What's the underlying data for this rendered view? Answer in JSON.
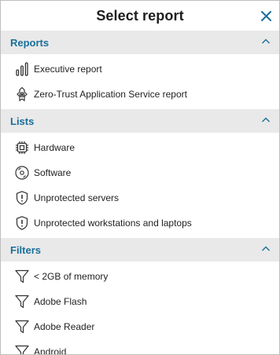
{
  "dialog": {
    "title": "Select report"
  },
  "colors": {
    "section_title": "#1a6f9a",
    "close_icon": "#1a6f9a",
    "section_bg": "#e9e9e9"
  },
  "sections": [
    {
      "title": "Reports",
      "items": [
        {
          "label": "Executive report",
          "icon": "bar-chart-icon"
        },
        {
          "label": "Zero-Trust Application Service report",
          "icon": "zero-trust-shield-icon"
        }
      ]
    },
    {
      "title": "Lists",
      "items": [
        {
          "label": "Hardware",
          "icon": "chip-icon"
        },
        {
          "label": "Software",
          "icon": "disc-icon"
        },
        {
          "label": "Unprotected servers",
          "icon": "shield-warning-icon"
        },
        {
          "label": "Unprotected workstations and laptops",
          "icon": "shield-warning-icon"
        }
      ]
    },
    {
      "title": "Filters",
      "items": [
        {
          "label": "< 2GB of memory",
          "icon": "filter-icon"
        },
        {
          "label": "Adobe Flash",
          "icon": "filter-icon"
        },
        {
          "label": "Adobe Reader",
          "icon": "filter-icon"
        },
        {
          "label": "Android",
          "icon": "filter-icon"
        }
      ]
    }
  ]
}
